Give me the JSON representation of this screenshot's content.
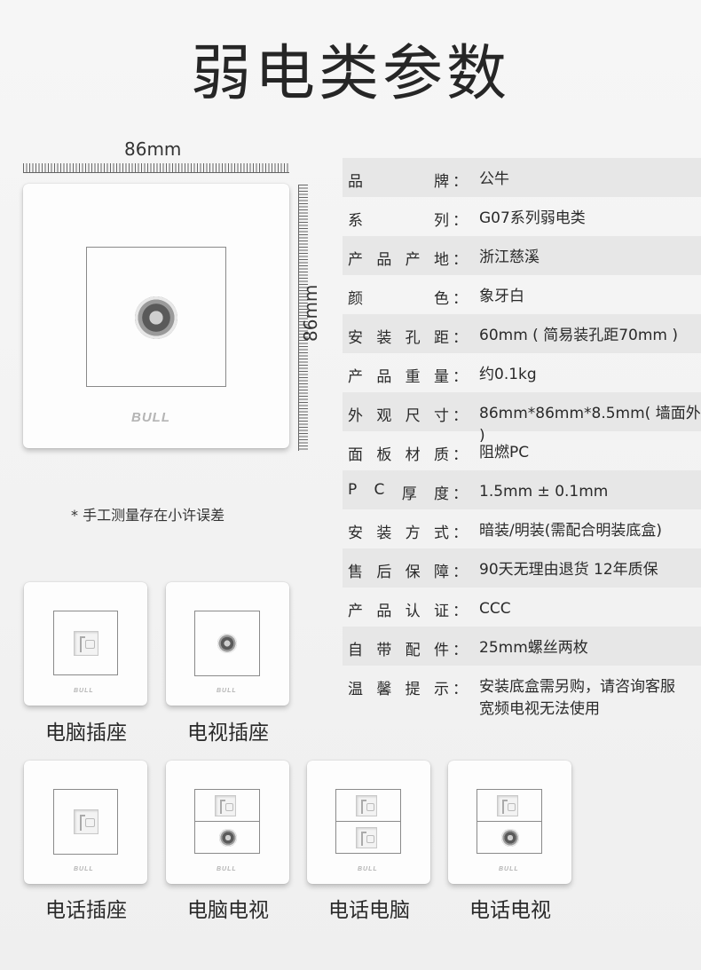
{
  "title": "弱电类参数",
  "dimensions": {
    "width_label": "86mm",
    "height_label": "86mm"
  },
  "brand_logo": "BULL",
  "note": "* 手工测量存在小许误差",
  "specs": [
    {
      "key": "品牌",
      "value": "公牛"
    },
    {
      "key": "系列",
      "value": "G07系列弱电类"
    },
    {
      "key": "产品产地",
      "value": "浙江慈溪"
    },
    {
      "key": "颜色",
      "value": "象牙白"
    },
    {
      "key": "安装孔距",
      "value": "60mm ( 简易装孔距70mm )"
    },
    {
      "key": "产品重量",
      "value": "约0.1kg"
    },
    {
      "key": "外观尺寸",
      "value": "86mm*86mm*8.5mm( 墙面外 )"
    },
    {
      "key": "面板材质",
      "value": "阻燃PC"
    },
    {
      "key": "PC厚度",
      "value": "1.5mm ± 0.1mm"
    },
    {
      "key": "安装方式",
      "value": "暗装/明装(需配合明装底盒)"
    },
    {
      "key": "售后保障",
      "value": "90天无理由退货 12年质保"
    },
    {
      "key": "产品认证",
      "value": "CCC"
    },
    {
      "key": "自带配件",
      "value": "25mm螺丝两枚"
    },
    {
      "key": "温馨提示",
      "value_lines": [
        "安装底盒需另购，请咨询客服",
        "宽频电视无法使用"
      ]
    }
  ],
  "spec_colon": "：",
  "products": [
    {
      "caption": "电脑插座"
    },
    {
      "caption": "电视插座"
    },
    {
      "caption": "电话插座"
    },
    {
      "caption": "电脑电视"
    },
    {
      "caption": "电话电脑"
    },
    {
      "caption": "电话电视"
    }
  ]
}
